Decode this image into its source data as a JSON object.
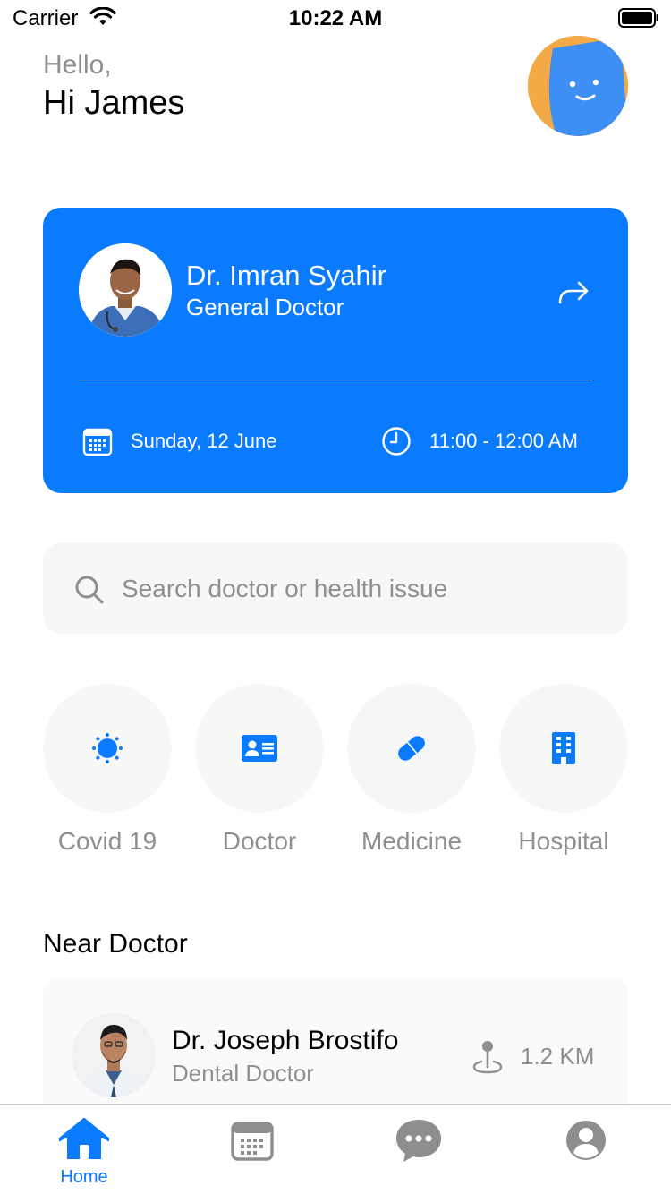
{
  "status_bar": {
    "carrier": "Carrier",
    "time": "10:22 AM"
  },
  "header": {
    "greeting": "Hello,",
    "username": "Hi James"
  },
  "appointment": {
    "doctor_name": "Dr. Imran Syahir",
    "doctor_role": "General Doctor",
    "date": "Sunday, 12 June",
    "time": "11:00 - 12:00 AM"
  },
  "search": {
    "placeholder": "Search doctor or health issue"
  },
  "categories": [
    {
      "label": "Covid 19",
      "icon": "virus-icon"
    },
    {
      "label": "Doctor",
      "icon": "id-card-icon"
    },
    {
      "label": "Medicine",
      "icon": "pill-icon"
    },
    {
      "label": "Hospital",
      "icon": "building-icon"
    }
  ],
  "near_doctor": {
    "title": "Near Doctor",
    "items": [
      {
        "name": "Dr. Joseph Brostifo",
        "role": "Dental Doctor",
        "distance": "1.2 KM"
      }
    ]
  },
  "tab_bar": {
    "tabs": [
      {
        "label": "Home",
        "icon": "home-icon",
        "active": true
      },
      {
        "label": "",
        "icon": "calendar-icon",
        "active": false
      },
      {
        "label": "",
        "icon": "chat-icon",
        "active": false
      },
      {
        "label": "",
        "icon": "profile-icon",
        "active": false
      }
    ]
  },
  "colors": {
    "primary": "#0a7aff",
    "muted_text": "#8e8e93",
    "surface": "#f7f7f7",
    "inactive_icon": "#8e8e8e"
  }
}
